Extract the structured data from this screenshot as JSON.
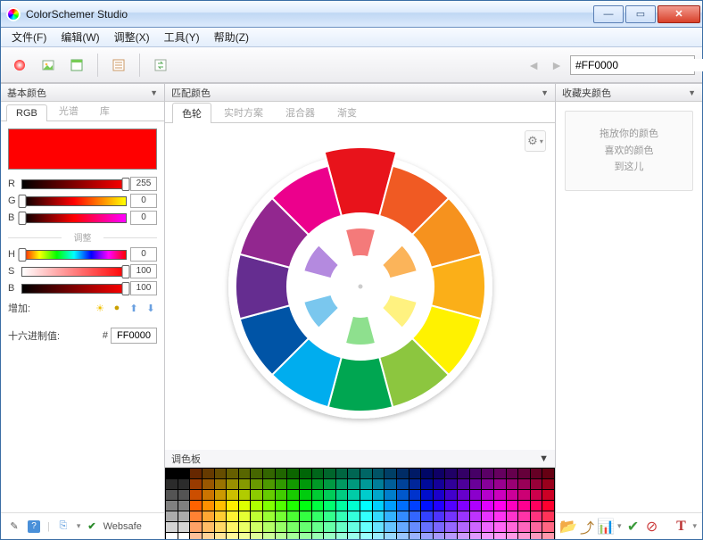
{
  "window": {
    "title": "ColorSchemer Studio"
  },
  "menu": {
    "file": "文件(F)",
    "edit": "编辑(W)",
    "adjust": "调整(X)",
    "tools": "工具(Y)",
    "help": "帮助(Z)"
  },
  "hex_display": {
    "value": "#FF0000",
    "swatch": "#FF0000"
  },
  "panels": {
    "base": {
      "title": "基本颜色"
    },
    "match": {
      "title": "匹配颜色"
    },
    "fav": {
      "title": "收藏夹颜色"
    },
    "pal": {
      "title": "调色板"
    }
  },
  "left_tabs": {
    "rgb": "RGB",
    "spectrum": "光谱",
    "lib": "库"
  },
  "sliders": {
    "R": {
      "label": "R",
      "value": "255",
      "grad": "linear-gradient(to right,#000,#f00)",
      "pos": 100
    },
    "G": {
      "label": "G",
      "value": "0",
      "grad": "linear-gradient(to right,#000,#f00,#ff0)",
      "pos": 0
    },
    "B": {
      "label": "B",
      "value": "0",
      "grad": "linear-gradient(to right,#000,#f00,#f0f)",
      "pos": 0
    },
    "adjust_label": "调整",
    "H": {
      "label": "H",
      "value": "0",
      "grad": "linear-gradient(to right,red,yellow,lime,cyan,blue,magenta,red)",
      "pos": 0
    },
    "S": {
      "label": "S",
      "value": "100",
      "grad": "linear-gradient(to right,#fff,#f00)",
      "pos": 100
    },
    "Bv": {
      "label": "B",
      "value": "100",
      "grad": "linear-gradient(to right,#000,#f00)",
      "pos": 100
    }
  },
  "increase_label": "增加:",
  "hex_label": "十六进制值:",
  "hex_prefix": "#",
  "hex_value": "FF0000",
  "websafe_label": "Websafe",
  "center_tabs": {
    "wheel": "色轮",
    "live": "实时方案",
    "mixer": "混合器",
    "grad": "渐变"
  },
  "fav_drop": {
    "l1": "拖放你的颜色",
    "l2": "喜欢的颜色",
    "l3": "到这儿"
  },
  "current_swatch": "#FF0000"
}
